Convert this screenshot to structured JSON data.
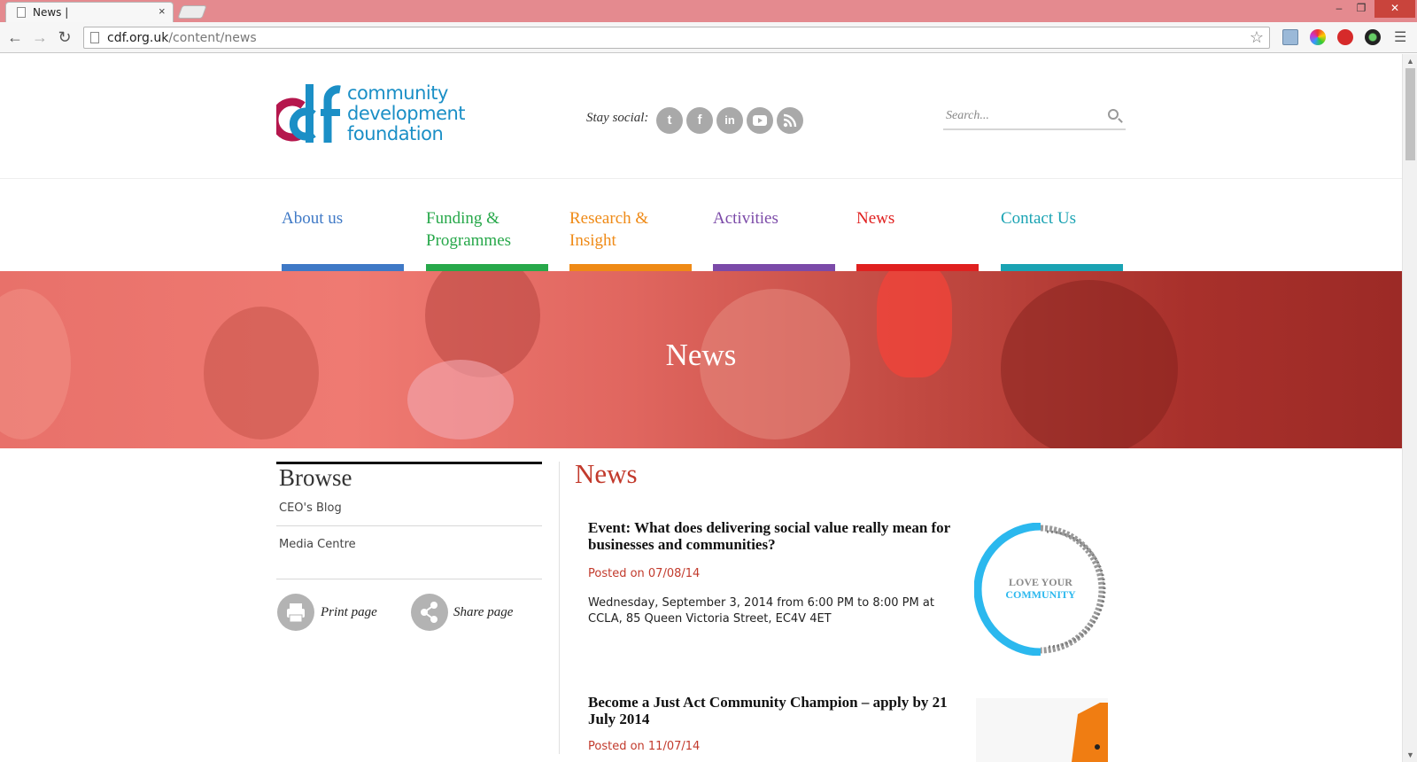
{
  "browser": {
    "tab_title": "News |",
    "tab_close": "×",
    "url_domain": "cdf.org.uk",
    "url_path": "/content/news",
    "window_min": "–",
    "window_max": "❐",
    "window_close": "✕"
  },
  "header": {
    "logo_lines": [
      "community",
      "development",
      "foundation"
    ],
    "stay_social": "Stay social:",
    "social_icons": [
      "twitter-icon",
      "facebook-icon",
      "linkedin-icon",
      "youtube-icon",
      "rss-icon"
    ],
    "search_placeholder": "Search..."
  },
  "nav": {
    "items": [
      {
        "label": "About us",
        "color": "#3f79c6"
      },
      {
        "label": "Funding & Programmes",
        "color": "#27a84a"
      },
      {
        "label": "Research & Insight",
        "color": "#ef8a16"
      },
      {
        "label": "Activities",
        "color": "#7b4aa8"
      },
      {
        "label": "News",
        "color": "#e0201f"
      },
      {
        "label": "Contact Us",
        "color": "#1aa3b3"
      }
    ]
  },
  "hero": {
    "title": "News"
  },
  "sidebar": {
    "title": "Browse",
    "links": [
      "CEO's Blog",
      "Media Centre"
    ],
    "print_label": "Print page",
    "share_label": "Share page"
  },
  "main": {
    "title": "News",
    "articles": [
      {
        "title": "Event: What does delivering social value really mean for businesses and communities?",
        "date": "Posted on 07/08/14",
        "summary": "Wednesday, September 3, 2014 from 6:00 PM to 8:00 PM at CCLA, 85 Queen Victoria Street, EC4V 4ET",
        "image_text": "LOVE YOUR COMMUNITY"
      },
      {
        "title": "Become a Just Act Community Champion – apply by 21 July 2014",
        "date": "Posted on 11/07/14"
      }
    ]
  },
  "colors": {
    "accent_red": "#c23a2c",
    "brand_blue": "#1b8fc6",
    "brand_magenta": "#b5174d"
  }
}
